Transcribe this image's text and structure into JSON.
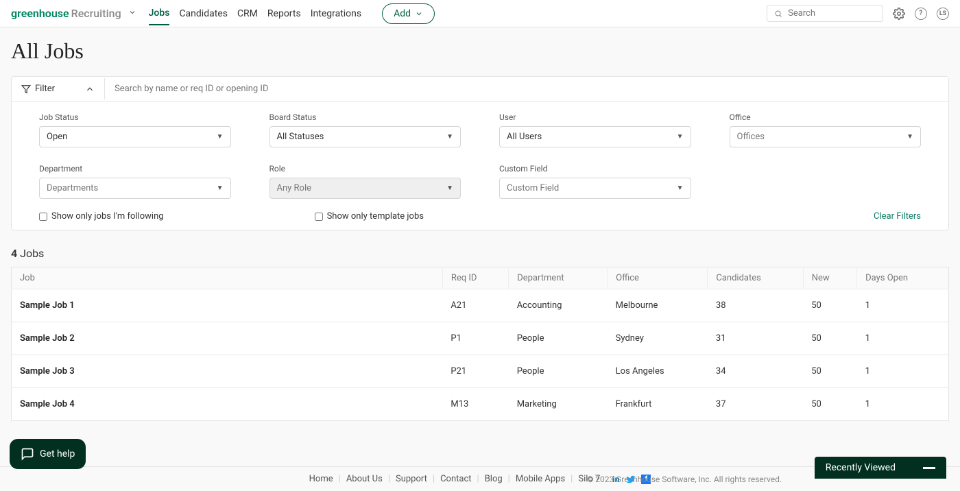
{
  "brand": {
    "name1": "greenhouse",
    "name2": "Recruiting"
  },
  "nav": {
    "items": [
      "Jobs",
      "Candidates",
      "CRM",
      "Reports",
      "Integrations"
    ],
    "add_label": "Add"
  },
  "search": {
    "placeholder": "Search"
  },
  "avatar_initials": "LS",
  "page_title": "All Jobs",
  "filter": {
    "toggle_label": "Filter",
    "search_placeholder": "Search by name or req ID or opening ID",
    "fields": {
      "job_status": {
        "label": "Job Status",
        "value": "Open"
      },
      "board_status": {
        "label": "Board Status",
        "value": "All Statuses"
      },
      "user": {
        "label": "User",
        "value": "All Users"
      },
      "office": {
        "label": "Office",
        "value": "Offices"
      },
      "department": {
        "label": "Department",
        "value": "Departments"
      },
      "role": {
        "label": "Role",
        "value": "Any Role"
      },
      "custom_field": {
        "label": "Custom Field",
        "value": "Custom Field"
      }
    },
    "check_following": "Show only jobs I'm following",
    "check_template": "Show only template jobs",
    "clear_label": "Clear Filters"
  },
  "jobs_count": {
    "num": "4",
    "word": "Jobs"
  },
  "table": {
    "headers": {
      "job": "Job",
      "req_id": "Req ID",
      "department": "Department",
      "office": "Office",
      "candidates": "Candidates",
      "new": "New",
      "days_open": "Days Open"
    },
    "rows": [
      {
        "job": "Sample Job 1",
        "req_id": "A21",
        "department": "Accounting",
        "office": "Melbourne",
        "candidates": "38",
        "new": "50",
        "days_open": "1"
      },
      {
        "job": "Sample Job 2",
        "req_id": "P1",
        "department": "People",
        "office": "Sydney",
        "candidates": "31",
        "new": "50",
        "days_open": "1"
      },
      {
        "job": "Sample Job 3",
        "req_id": "P21",
        "department": "People",
        "office": "Los Angeles",
        "candidates": "34",
        "new": "50",
        "days_open": "1"
      },
      {
        "job": "Sample Job 4",
        "req_id": "M13",
        "department": "Marketing",
        "office": "Frankfurt",
        "candidates": "37",
        "new": "50",
        "days_open": "1"
      }
    ]
  },
  "footer": {
    "links": [
      "Home",
      "About Us",
      "Support",
      "Contact",
      "Blog",
      "Mobile Apps",
      "Silo 7"
    ],
    "copyright": "© 2023 Greenhouse Software, Inc. All rights reserved."
  },
  "chat_label": "Get help",
  "recent_label": "Recently Viewed"
}
